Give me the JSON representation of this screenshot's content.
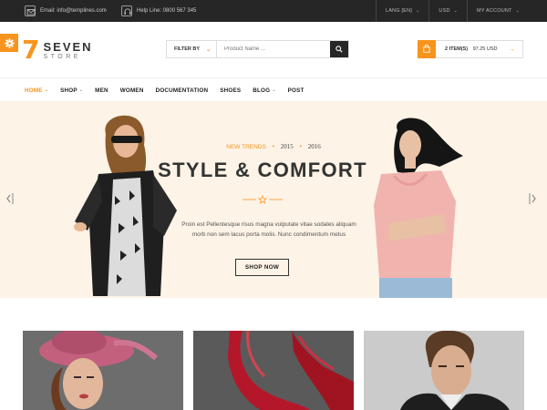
{
  "topbar": {
    "email": "Email: info@templines.com",
    "helpline": "Help Line: 0800 567 345",
    "language": "LANG [EN]",
    "currency": "USD",
    "account": "MY ACCOUNT"
  },
  "header": {
    "logo_top": "SEVEN",
    "logo_bottom": "STORE",
    "logo_digit": "7",
    "filter_label": "FILTER BY",
    "search_placeholder": "Product Name ...",
    "cart_items": "2 ITEM(S)",
    "cart_total": "97.25 USD"
  },
  "nav": {
    "items": [
      {
        "label": "HOME",
        "dropdown": true,
        "active": true
      },
      {
        "label": "SHOP",
        "dropdown": true,
        "active": false
      },
      {
        "label": "MEN",
        "dropdown": false,
        "active": false
      },
      {
        "label": "WOMEN",
        "dropdown": false,
        "active": false
      },
      {
        "label": "DOCUMENTATION",
        "dropdown": false,
        "active": false
      },
      {
        "label": "SHOES",
        "dropdown": false,
        "active": false
      },
      {
        "label": "BLOG",
        "dropdown": true,
        "active": false
      },
      {
        "label": "POST",
        "dropdown": false,
        "active": false
      }
    ]
  },
  "hero": {
    "kicker": "NEW TRENDS",
    "year1": "2015",
    "year2": "2016",
    "title": "STYLE & COMFORT",
    "desc_line1": "Proin est Pellentesque risus magna vulputate vitae sodales aliquam",
    "desc_line2": "morb non sem lacus porta molis. Nunc condimentum metus",
    "cta": "SHOP NOW"
  },
  "colors": {
    "accent": "#f7941d",
    "topbar": "#262626",
    "hero_bg": "#fdf3e6"
  },
  "icons": {
    "settings": "gear-icon",
    "email": "envelope-icon",
    "help": "headset-icon",
    "search": "search-icon",
    "cart": "shopping-bag-icon",
    "hero_prev": "chevron-left-icon",
    "hero_next": "chevron-right-icon"
  }
}
